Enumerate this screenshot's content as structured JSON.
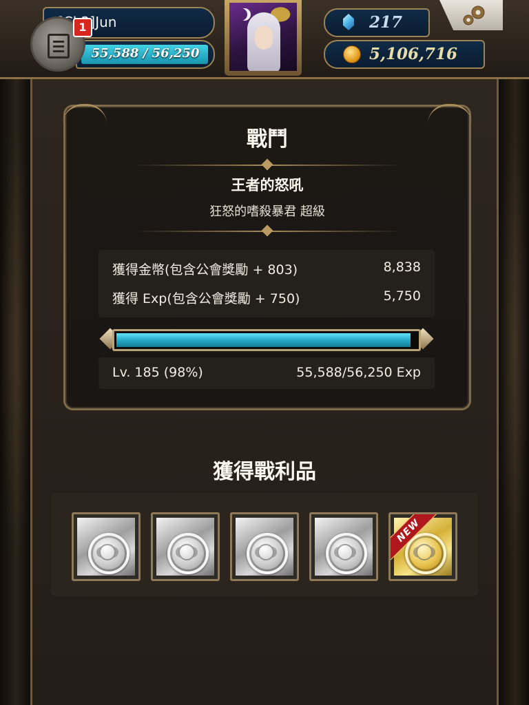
{
  "topbar": {
    "player_name": "[Cl 2]Jun",
    "notification_count": "1",
    "exp_display": "55,588 / 56,250",
    "exp_fraction": 0.988,
    "gems": "217",
    "coins": "5,106,716"
  },
  "battle": {
    "title": "戰鬥",
    "stage_name": "王者的怒吼",
    "stage_subtitle": "狂怒的嗜殺暴君 超級",
    "rewards": [
      {
        "label": "獲得金幣(包含公會獎勵 + 803)",
        "value": "8,838"
      },
      {
        "label": "獲得 Exp(包含公會獎勵 + 750)",
        "value": "5,750"
      }
    ],
    "exp_fraction": 0.98,
    "level_text": "Lv. 185 (98%)",
    "exp_text": "55,588/56,250 Exp"
  },
  "loot": {
    "title": "獲得戰利品",
    "items": [
      {
        "type": "silver-card",
        "is_new": false
      },
      {
        "type": "silver-card",
        "is_new": false
      },
      {
        "type": "silver-card",
        "is_new": false
      },
      {
        "type": "silver-card",
        "is_new": false
      },
      {
        "type": "gold-card",
        "is_new": true,
        "badge": "NEW"
      }
    ]
  },
  "colors": {
    "exp_bar": "#21a6c2",
    "gold_frame": "#a88d5c",
    "new_ribbon": "#b0171d"
  }
}
